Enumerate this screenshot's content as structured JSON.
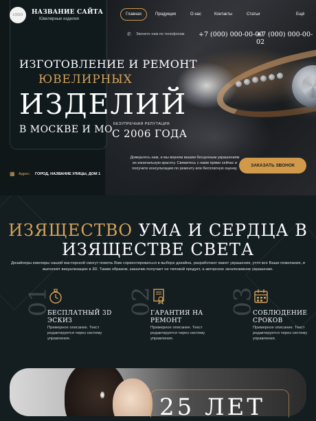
{
  "header": {
    "logo_text": "LOGO",
    "site_name": "НАЗВАНИЕ САЙТА",
    "site_subtitle": "Ювелирные изделия"
  },
  "nav": {
    "items": [
      {
        "label": "Главная",
        "active": true
      },
      {
        "label": "Продукция",
        "active": false
      },
      {
        "label": "О нас",
        "active": false
      },
      {
        "label": "Контакты",
        "active": false
      },
      {
        "label": "Статьи",
        "active": false
      },
      {
        "label": "Ещё",
        "active": false
      }
    ]
  },
  "contacts": {
    "call_label": "Звоните нам по телефонам",
    "phone1": "+7 (000) 000-00-00",
    "phone2": "+7 (000) 000-00-02",
    "address_label": "Адрес:",
    "address_value": "ГОРОД, НАЗВАНИЕ УЛИЦЫ, ДОМ 1"
  },
  "hero": {
    "line1": "ИЗГОТОВЛЕНИЕ И РЕМОНТ",
    "line2": "ЮВЕЛИРНЫХ",
    "line3": "ИЗДЕЛИЙ",
    "line4": "В МОСКВЕ И МО",
    "reputation_label": "БЕЗУПРЕЧНАЯ РЕПУТАЦИЯ",
    "reputation_years": "С 2006 ГОДА",
    "description": "Доверьтесь нам, и мы вернем вашим бесценным украшениям их изначальную красоту. Свяжитесь с нами прямо сейчас и получите консультацию по ремонту или бесплатную оценку.",
    "cta_label": "ЗАКАЗАТЬ ЗВОНОК"
  },
  "section": {
    "title_gold": "ИЗЯЩЕСТВО",
    "title_rest": " УМА И СЕРДЦА В",
    "title_line2": "ИЗЯЩЕСТВЕ СВЕТА",
    "description": "Дизайнеры ювелиры нашей мастерской смогут помочь Вам сориентироваться в выборе дизайна, разработают макет украшения, учтя все Ваши пожелания, и выполнят визуализацию в 3D. Таким образом, заказчик получает не типовой продукт, а авторское эксклюзивное украшение.",
    "features": [
      {
        "num": "01",
        "icon": "stopwatch-icon",
        "title_l1": "БЕСПЛАТНЫЙ 3D",
        "title_l2": "ЭСКИЗ",
        "text": "Примерное описание. Текст редактируется через систему управления."
      },
      {
        "num": "02",
        "icon": "certificate-icon",
        "title_l1": "ГАРАНТИЯ НА",
        "title_l2": "РЕМОНТ",
        "text": "Примерное описание. Текст редактируется через систему управления."
      },
      {
        "num": "03",
        "icon": "calendar-icon",
        "title_l1": "СОБЛЮДЕНИЕ",
        "title_l2": "СРОКОВ",
        "text": "Примерное описание. Текст редактируется через систему управления."
      }
    ]
  },
  "stats": {
    "value": "25 ЛЕТ"
  },
  "colors": {
    "accent": "#d4a359",
    "button": "#d19a4a",
    "background": "#141d20"
  }
}
